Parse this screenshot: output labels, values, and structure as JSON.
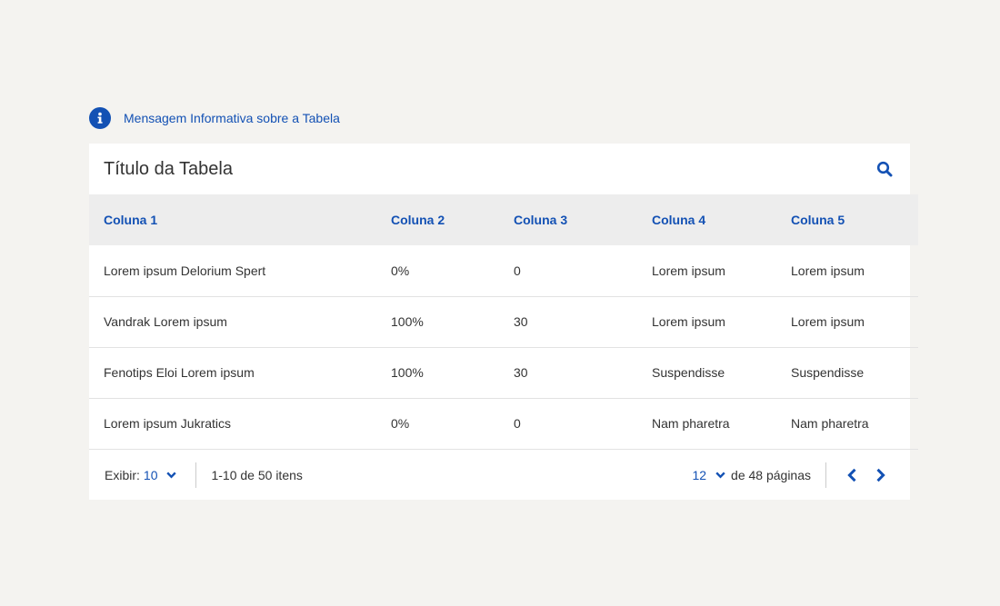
{
  "info": {
    "icon": "info-circle-icon",
    "message": "Mensagem Informativa sobre a Tabela"
  },
  "table": {
    "title": "Título da Tabela",
    "search_icon": "search-icon",
    "columns": [
      "Coluna 1",
      "Coluna 2",
      "Coluna 3",
      "Coluna 4",
      "Coluna 5"
    ],
    "rows": [
      [
        "Lorem ipsum Delorium Spert",
        "0%",
        "0",
        "Lorem ipsum",
        "Lorem ipsum"
      ],
      [
        "Vandrak Lorem ipsum",
        "100%",
        "30",
        "Lorem ipsum",
        "Lorem ipsum"
      ],
      [
        "Fenotips Eloi Lorem ipsum",
        "100%",
        "30",
        "Suspendisse",
        "Suspendisse"
      ],
      [
        "Lorem ipsum Jukratics",
        "0%",
        "0",
        "Nam pharetra",
        "Nam pharetra"
      ]
    ]
  },
  "footer": {
    "show_label": "Exibir:",
    "page_size": "10",
    "items_range": "1-10 de 50 itens",
    "current_page": "12",
    "pages_of": "de 48 páginas",
    "prev_icon": "chevron-left-icon",
    "next_icon": "chevron-right-icon"
  },
  "colors": {
    "primary": "#1351b4",
    "text": "#333333",
    "background": "#f4f3f0",
    "header_row": "#ededed"
  }
}
